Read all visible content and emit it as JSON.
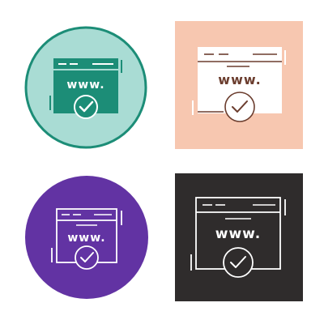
{
  "icon_set": {
    "icon": "website-verified-icon",
    "url_text": "www.",
    "variants": [
      {
        "name": "teal-circle",
        "shape": "circle",
        "background": "#a9dcd4",
        "border": "#1c8d77",
        "icon_color": "#1c8d77",
        "line_color": "#ffffff"
      },
      {
        "name": "peach-square",
        "shape": "square",
        "background": "#f7c7b0",
        "icon_color": "#ffffff",
        "line_color": "#6b3d2e"
      },
      {
        "name": "purple-circle",
        "shape": "circle",
        "background": "#6233a3",
        "icon_color": "#ffffff"
      },
      {
        "name": "dark-square",
        "shape": "square",
        "background": "#2f2c2c",
        "icon_color": "#ffffff"
      }
    ]
  }
}
